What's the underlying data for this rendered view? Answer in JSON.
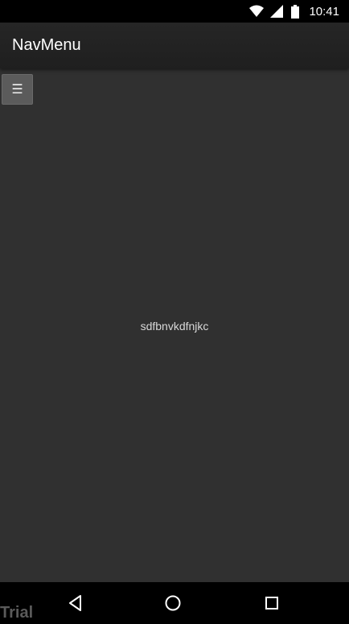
{
  "status_bar": {
    "time": "10:41",
    "icons": [
      "wifi-icon",
      "cell-signal-icon",
      "battery-icon"
    ]
  },
  "app_bar": {
    "title": "NavMenu"
  },
  "menu_button": {
    "label": "☰",
    "icon": "hamburger-menu-icon"
  },
  "content": {
    "text": "sdfbnvkdfnjkc"
  },
  "nav_bar": {
    "buttons": [
      "back-icon",
      "home-icon",
      "recents-icon"
    ],
    "watermark": "Trial"
  },
  "colors": {
    "background": "#303030",
    "app_bar": "#222222",
    "button": "#5b5b5b"
  }
}
